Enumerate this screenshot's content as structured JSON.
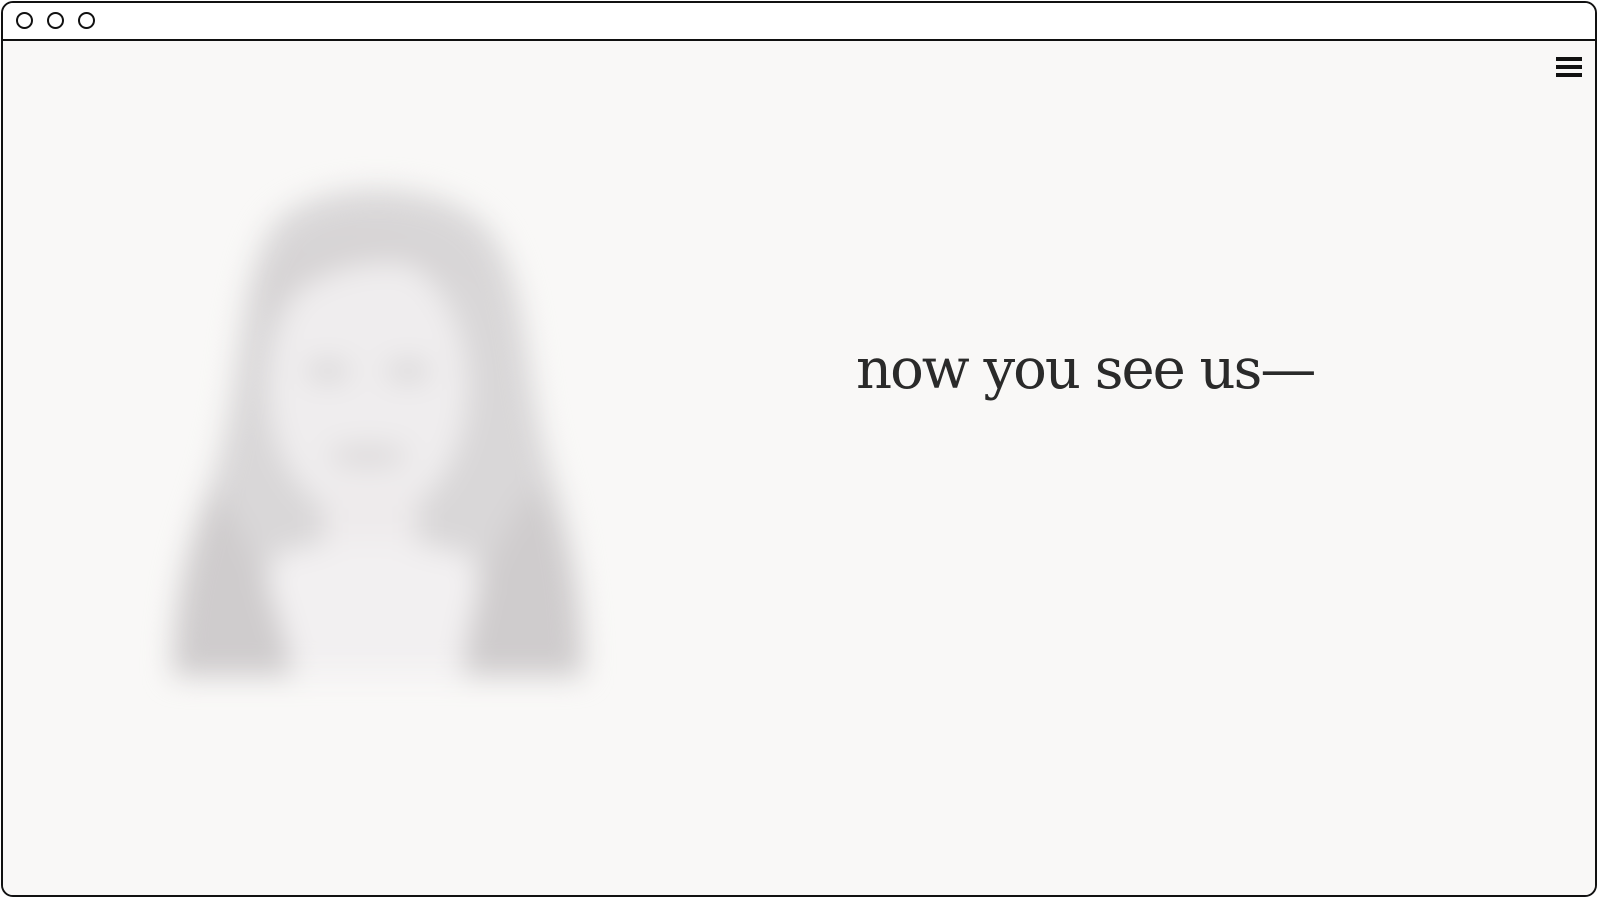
{
  "window": {
    "controls": [
      "close-control",
      "minimize-control",
      "maximize-control"
    ]
  },
  "header": {
    "menu_icon": "hamburger-menu-icon"
  },
  "hero": {
    "tagline": "now you see us—",
    "portrait_description_icon": "blurred-portrait-image"
  },
  "colors": {
    "background": "#f9f8f7",
    "text": "#2a2a2a",
    "frame": "#111111"
  }
}
